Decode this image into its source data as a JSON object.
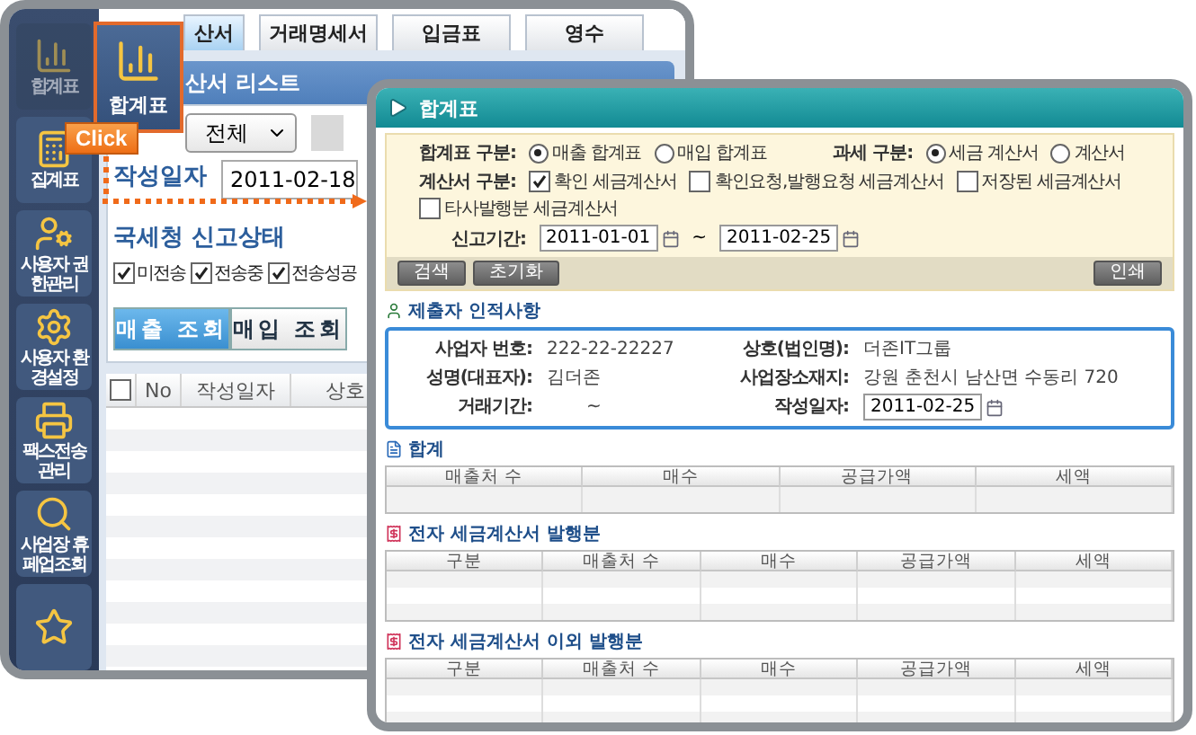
{
  "back_window": {
    "tabs": [
      {
        "label": "산서",
        "selected": true
      },
      {
        "label": "거래명세서",
        "selected": false
      },
      {
        "label": "입금표",
        "selected": false
      },
      {
        "label": "영수",
        "selected": false
      }
    ],
    "sidebar": [
      {
        "label": "합계표",
        "selected": true
      },
      {
        "label": "집계표",
        "selected": false
      },
      {
        "label": "사용자 권한관리",
        "selected": false
      },
      {
        "label": "사용자 환경설정",
        "selected": false
      },
      {
        "label": "팩스전송 관리",
        "selected": false
      },
      {
        "label": "사업장 휴페업조회",
        "selected": false
      },
      {
        "selected": false
      }
    ],
    "highlight_button": {
      "label": "합계표"
    },
    "click_badge": "Click",
    "panel": {
      "title": "산서 리스트",
      "dropdown": "전체",
      "date_label": "작성일자",
      "date": "2011-02-18",
      "status_label": "국세청 신고상태",
      "status_checks": [
        {
          "label": "미전송",
          "checked": true
        },
        {
          "label": "전송중",
          "checked": true
        },
        {
          "label": "전송성공",
          "checked": true
        }
      ],
      "view_buttons": [
        {
          "label": "매출 조회",
          "selected": true
        },
        {
          "label": "매입 조회",
          "selected": false
        }
      ],
      "select_all": {
        "checked": false
      },
      "table_columns": [
        "No",
        "작성일자",
        "상호"
      ]
    }
  },
  "popup": {
    "title": "합계표",
    "filters": {
      "summary_type": {
        "label": "합계표 구분:",
        "options": [
          {
            "label": "매출 합계표",
            "selected": true
          },
          {
            "label": "매입 합계표",
            "selected": false
          }
        ]
      },
      "tax_type": {
        "label": "과세 구분:",
        "options": [
          {
            "label": "세금 계산서",
            "selected": true
          },
          {
            "label": "계산서",
            "selected": false
          }
        ]
      },
      "invoice_type": {
        "label": "계산서 구분:",
        "options": [
          {
            "label": "확인 세금계산서",
            "checked": true
          },
          {
            "label": "확인요청,발행요청 세금계산서",
            "checked": false
          },
          {
            "label": "저장된 세금계산서",
            "checked": false
          },
          {
            "label": "타사발행분 세금계산서",
            "checked": false
          }
        ]
      },
      "period": {
        "label": "신고기간:",
        "from": "2011-01-01",
        "separator": "~",
        "to": "2011-02-25"
      }
    },
    "buttons": {
      "left": [
        "검색",
        "초기화"
      ],
      "right": [
        "인쇄"
      ]
    },
    "submitter": {
      "title": "제출자 인적사항",
      "fields": [
        {
          "label": "사업자 번호:",
          "value": "222-22-22227",
          "kind": "text"
        },
        {
          "label": "상호(법인명):",
          "value": "더존IT그룹",
          "kind": "text"
        },
        {
          "label": "성명(대표자):",
          "value": "김더존",
          "kind": "text"
        },
        {
          "label": "사업장소재지:",
          "value": "강원 춘천시 남산면 수동리 720",
          "kind": "text"
        },
        {
          "label": "거래기간:",
          "value": "~",
          "kind": "text"
        },
        {
          "label": "작성일자:",
          "value": "2011-02-25",
          "kind": "date"
        }
      ]
    },
    "sections": [
      {
        "title": "합계",
        "kind": "total",
        "columns": [
          "매출처 수",
          "매수",
          "공급가액",
          "세액"
        ]
      },
      {
        "title": "전자 세금계산서 발행분",
        "kind": "issued",
        "columns": [
          "구분",
          "매출처 수",
          "매수",
          "공급가액",
          "세액"
        ]
      },
      {
        "title": "전자 세금계산서 이외 발행분",
        "kind": "issued",
        "columns": [
          "구분",
          "매출처 수",
          "매수",
          "공급가액",
          "세액"
        ]
      }
    ]
  }
}
